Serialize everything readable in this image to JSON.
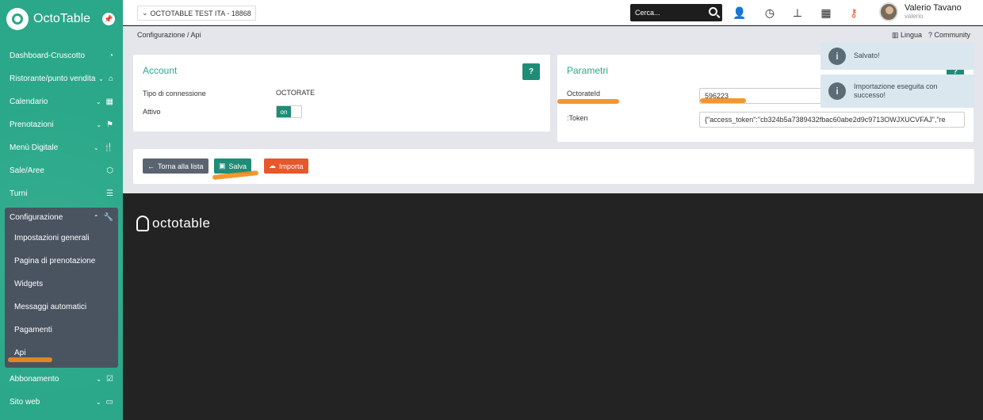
{
  "brand": {
    "name": "OctoTable"
  },
  "sidebar": {
    "items": [
      {
        "label": "Dashboard-Cruscotto",
        "chevron": false,
        "icon": "gauge-icon"
      },
      {
        "label": "Ristorante/punto vendita",
        "chevron": true,
        "icon": "home-icon"
      },
      {
        "label": "Calendario",
        "chevron": true,
        "icon": "calendar-icon"
      },
      {
        "label": "Prenotazioni",
        "chevron": true,
        "icon": "flag-icon"
      },
      {
        "label": "Menù Digitale",
        "chevron": true,
        "icon": "cutlery-icon"
      },
      {
        "label": "Sale/Aree",
        "chevron": false,
        "icon": "cube-icon"
      },
      {
        "label": "Turni",
        "chevron": false,
        "icon": "list-icon"
      }
    ],
    "config": {
      "label": "Configurazione",
      "sub": [
        "Impostazioni generali",
        "Pagina di prenotazione",
        "Widgets",
        "Messaggi automatici",
        "Pagamenti",
        "Api"
      ]
    },
    "after": [
      {
        "label": "Abbonamento",
        "chevron": true,
        "icon": "check-square-icon"
      },
      {
        "label": "Sito web",
        "chevron": true,
        "icon": "monitor-icon"
      }
    ]
  },
  "topbar": {
    "venue": "OCTOTABLE TEST ITA - 18868",
    "search_placeholder": "Cerca...",
    "user_name": "Valerio Tavano",
    "user_sub": "valerio"
  },
  "content": {
    "breadcrumb": "Configurazione / Api",
    "lingua": "Lingua",
    "community": "Community"
  },
  "account": {
    "title": "Account",
    "help": "?",
    "connection_label": "Tipo di connessione",
    "connection_value": "OCTORATE",
    "active_label": "Attivo",
    "toggle_on": "on"
  },
  "params": {
    "title": "Parametri",
    "help": "?",
    "octorate_label": "OctorateId",
    "octorate_value": "596223",
    "token_label": ":Token",
    "token_value": "{\"access_token\":\"cb324b5a7389432fbac60abe2d9c9713OWJXUCVFAJ\",\"re"
  },
  "actions": {
    "back": "Torna alla lista",
    "save": "Salva",
    "import": "Importa"
  },
  "notifications": [
    {
      "text": "Salvato!"
    },
    {
      "text": "Importazione eseguita con successo!"
    }
  ],
  "footer": {
    "logo_text": "octotable"
  }
}
